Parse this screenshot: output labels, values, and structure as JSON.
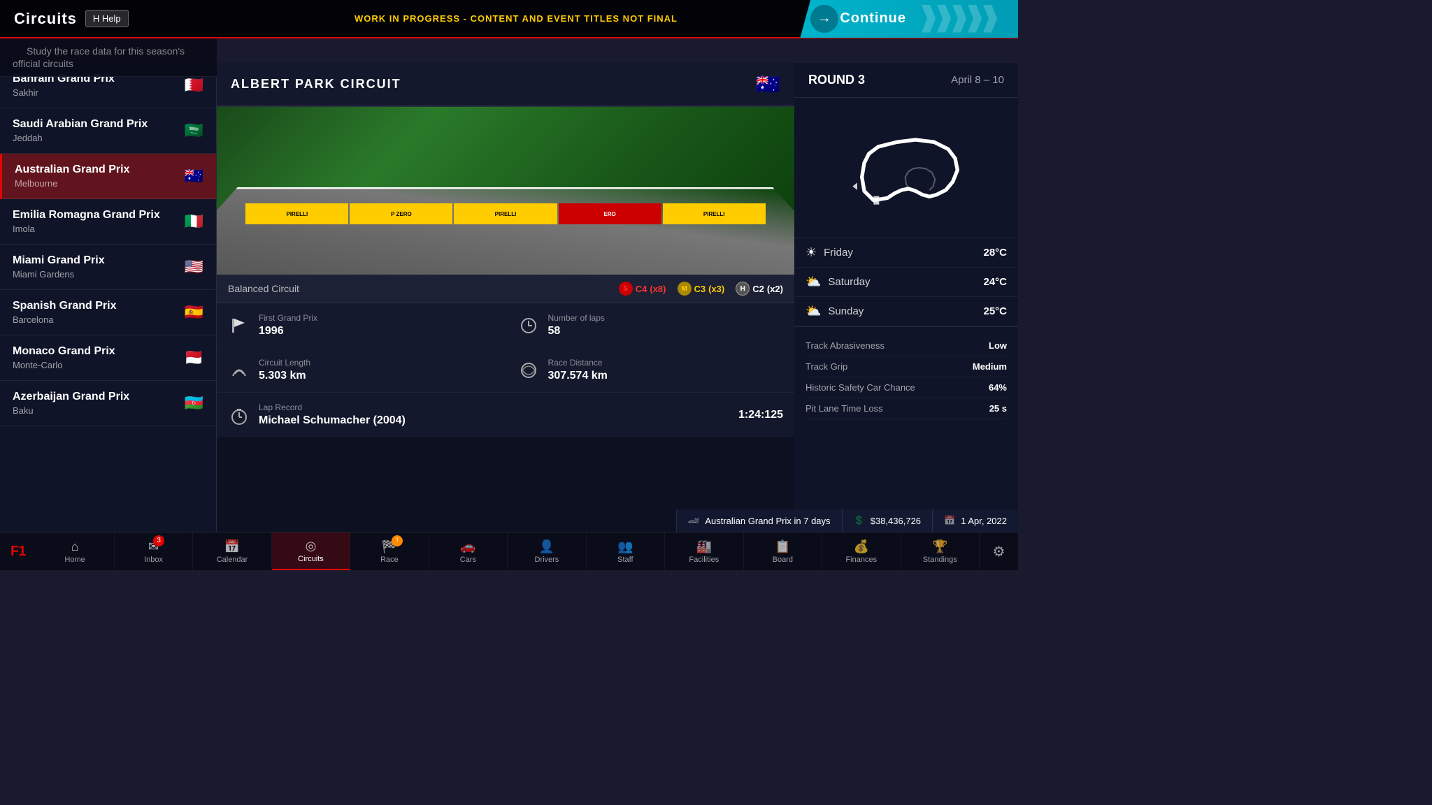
{
  "header": {
    "title": "Circuits",
    "subtitle": "Study the race data for this season's official circuits",
    "help_label": "H  Help",
    "wip_notice": "WORK IN PROGRESS - CONTENT AND EVENT TITLES NOT FINAL",
    "continue_label": "Continue"
  },
  "circuits": [
    {
      "id": "bahrain",
      "name": "Bahrain Grand Prix",
      "city": "Sakhir",
      "flag": "🇧🇭",
      "active": false
    },
    {
      "id": "saudi",
      "name": "Saudi Arabian Grand Prix",
      "city": "Jeddah",
      "flag": "🇸🇦",
      "active": false
    },
    {
      "id": "australia",
      "name": "Australian Grand Prix",
      "city": "Melbourne",
      "flag": "🇦🇺",
      "active": true
    },
    {
      "id": "emilia",
      "name": "Emilia Romagna Grand Prix",
      "city": "Imola",
      "flag": "🇮🇹",
      "active": false
    },
    {
      "id": "miami",
      "name": "Miami Grand Prix",
      "city": "Miami Gardens",
      "flag": "🇺🇸",
      "active": false
    },
    {
      "id": "spain",
      "name": "Spanish Grand Prix",
      "city": "Barcelona",
      "flag": "🇪🇸",
      "active": false
    },
    {
      "id": "monaco",
      "name": "Monaco Grand Prix",
      "city": "Monte-Carlo",
      "flag": "🇲🇨",
      "active": false
    },
    {
      "id": "azerbaijan",
      "name": "Azerbaijan Grand Prix",
      "city": "Baku",
      "flag": "🇦🇿",
      "active": false
    }
  ],
  "selected_circuit": {
    "name": "ALBERT PARK CIRCUIT",
    "flag": "🇦🇺",
    "type": "Balanced Circuit",
    "tyres": {
      "soft": {
        "label": "C4",
        "count": 8
      },
      "medium": {
        "label": "C3",
        "count": 3
      },
      "hard": {
        "label": "C2",
        "count": 2
      }
    },
    "first_grand_prix_label": "First Grand Prix",
    "first_grand_prix_value": "1996",
    "laps_label": "Number of laps",
    "laps_value": "58",
    "length_label": "Circuit Length",
    "length_value": "5.303 km",
    "race_distance_label": "Race Distance",
    "race_distance_value": "307.574 km",
    "lap_record_label": "Lap Record",
    "lap_record_holder": "Michael Schumacher (2004)",
    "lap_record_time": "1:24:125"
  },
  "round_info": {
    "label": "ROUND 3",
    "dates": "April 8 – 10",
    "weather": [
      {
        "day": "Friday",
        "icon": "☀",
        "temp": "28°C",
        "condition": "sunny"
      },
      {
        "day": "Saturday",
        "icon": "🌥",
        "temp": "24°C",
        "condition": "cloudy"
      },
      {
        "day": "Sunday",
        "icon": "🌥",
        "temp": "25°C",
        "condition": "cloudy"
      }
    ],
    "track_stats": [
      {
        "label": "Track Abrasiveness",
        "value": "Low"
      },
      {
        "label": "Track Grip",
        "value": "Medium"
      },
      {
        "label": "Historic Safety Car Chance",
        "value": "64%"
      },
      {
        "label": "Pit Lane Time Loss",
        "value": "25 s"
      }
    ]
  },
  "status_bar": {
    "event": "Australian Grand Prix in 7 days",
    "money": "$38,436,726",
    "date": "1 Apr, 2022"
  },
  "nav": {
    "items": [
      {
        "id": "home",
        "label": "Home",
        "icon": "⌂",
        "active": false,
        "badge": null
      },
      {
        "id": "inbox",
        "label": "Inbox",
        "icon": "✉",
        "active": false,
        "badge": "3"
      },
      {
        "id": "calendar",
        "label": "Calendar",
        "icon": "📅",
        "active": false,
        "badge": null
      },
      {
        "id": "circuits",
        "label": "Circuits",
        "icon": "◎",
        "active": true,
        "badge": null
      },
      {
        "id": "race",
        "label": "Race",
        "icon": "🏁",
        "active": false,
        "badge": "!"
      },
      {
        "id": "cars",
        "label": "Cars",
        "icon": "🚗",
        "active": false,
        "badge": null
      },
      {
        "id": "drivers",
        "label": "Drivers",
        "icon": "👤",
        "active": false,
        "badge": null
      },
      {
        "id": "staff",
        "label": "Staff",
        "icon": "👥",
        "active": false,
        "badge": null
      },
      {
        "id": "facilities",
        "label": "Facilities",
        "icon": "🏭",
        "active": false,
        "badge": null
      },
      {
        "id": "board",
        "label": "Board",
        "icon": "📋",
        "active": false,
        "badge": null
      },
      {
        "id": "finances",
        "label": "Finances",
        "icon": "💰",
        "active": false,
        "badge": null
      },
      {
        "id": "standings",
        "label": "Standings",
        "icon": "🏆",
        "active": false,
        "badge": null
      }
    ]
  }
}
